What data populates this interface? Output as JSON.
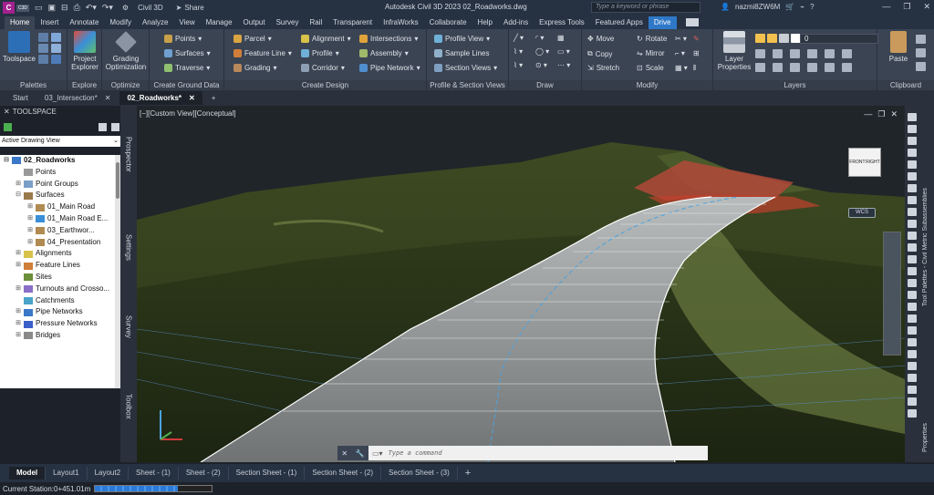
{
  "titlebar": {
    "badge": "C",
    "badge_sub": "C3D",
    "workspace": "Civil 3D",
    "share": "Share",
    "title": "Autodesk Civil 3D 2023   02_Roadworks.dwg",
    "search_placeholder": "Type a keyword or phrase",
    "user": "nazmi8ZW6M"
  },
  "ribbon_tabs": [
    "Home",
    "Insert",
    "Annotate",
    "Modify",
    "Analyze",
    "View",
    "Manage",
    "Output",
    "Survey",
    "Rail",
    "Transparent",
    "InfraWorks",
    "Collaborate",
    "Help",
    "Add-ins",
    "Express Tools",
    "Featured Apps",
    "Drive"
  ],
  "ribbon": {
    "palettes": {
      "toolspace": "Toolspace",
      "title": "Palettes"
    },
    "explore": {
      "project_explorer": "Project Explorer",
      "title": "Explore"
    },
    "optimize": {
      "grading_optimization": "Grading Optimization",
      "title": "Optimize"
    },
    "ground": {
      "points": "Points",
      "surfaces": "Surfaces",
      "traverse": "Traverse",
      "title": "Create Ground Data"
    },
    "design": {
      "parcel": "Parcel",
      "feature_line": "Feature Line",
      "grading": "Grading",
      "alignment": "Alignment",
      "profile": "Profile",
      "corridor": "Corridor",
      "intersections": "Intersections",
      "assembly": "Assembly",
      "pipe_network": "Pipe Network",
      "title": "Create Design"
    },
    "profile_section": {
      "profile_view": "Profile View",
      "sample_lines": "Sample Lines",
      "section_views": "Section Views",
      "title": "Profile & Section Views"
    },
    "draw": {
      "title": "Draw"
    },
    "modify": {
      "move": "Move",
      "copy": "Copy",
      "stretch": "Stretch",
      "rotate": "Rotate",
      "mirror": "Mirror",
      "scale": "Scale",
      "title": "Modify"
    },
    "layers": {
      "layer_properties": "Layer Properties",
      "current_layer": "0",
      "title": "Layers"
    },
    "clipboard": {
      "paste": "Paste",
      "title": "Clipboard"
    }
  },
  "file_tabs": [
    {
      "label": "Start",
      "closable": false
    },
    {
      "label": "03_Intersection*",
      "closable": true
    },
    {
      "label": "02_Roadworks*",
      "closable": true,
      "active": true
    }
  ],
  "toolspace": {
    "title": "TOOLSPACE",
    "view_select": "Active Drawing View",
    "tree": [
      {
        "label": "02_Roadworks",
        "indent": 0,
        "exp": "⊟",
        "icon": "drawing",
        "bold": true
      },
      {
        "label": "Points",
        "indent": 1,
        "exp": "",
        "icon": "points"
      },
      {
        "label": "Point Groups",
        "indent": 1,
        "exp": "⊞",
        "icon": "pointgroups"
      },
      {
        "label": "Surfaces",
        "indent": 1,
        "exp": "⊟",
        "icon": "surfaces"
      },
      {
        "label": "01_Main Road",
        "indent": 2,
        "exp": "⊞",
        "icon": "surface"
      },
      {
        "label": "01_Main Road E...",
        "indent": 2,
        "exp": "⊞",
        "icon": "surface-blue"
      },
      {
        "label": "03_Earthwor...",
        "indent": 2,
        "exp": "⊞",
        "icon": "surface"
      },
      {
        "label": "04_Presentation",
        "indent": 2,
        "exp": "⊞",
        "icon": "surface"
      },
      {
        "label": "Alignments",
        "indent": 1,
        "exp": "⊞",
        "icon": "alignments"
      },
      {
        "label": "Feature Lines",
        "indent": 1,
        "exp": "⊞",
        "icon": "featurelines"
      },
      {
        "label": "Sites",
        "indent": 1,
        "exp": "",
        "icon": "sites"
      },
      {
        "label": "Turnouts and Crosso...",
        "indent": 1,
        "exp": "⊞",
        "icon": "turnouts"
      },
      {
        "label": "Catchments",
        "indent": 1,
        "exp": "",
        "icon": "catchments"
      },
      {
        "label": "Pipe Networks",
        "indent": 1,
        "exp": "⊞",
        "icon": "pipes"
      },
      {
        "label": "Pressure Networks",
        "indent": 1,
        "exp": "⊞",
        "icon": "pressure"
      },
      {
        "label": "Bridges",
        "indent": 1,
        "exp": "⊞",
        "icon": "bridges"
      }
    ],
    "side_tabs": [
      "Prospector",
      "Settings",
      "Survey",
      "Toolbox"
    ]
  },
  "viewport": {
    "label": "[−][Custom View][Conceptual]",
    "viewcube_front": "FRONT",
    "viewcube_right": "RIGHT",
    "wcs": "WCS",
    "command_placeholder": "Type a command"
  },
  "right_palettes": [
    "Tool Palettes - Civil Metric Subassemblies",
    "Properties"
  ],
  "layout_tabs": [
    "Model",
    "Layout1",
    "Layout2",
    "Sheet - (1)",
    "Sheet - (2)",
    "Section Sheet - (1)",
    "Section Sheet - (2)",
    "Section Sheet - (3)"
  ],
  "status": {
    "station": "Current Station:0+451.01m",
    "progress": 0.71
  },
  "colors": {
    "accent": "#2e78c7",
    "badge": "#a3218e",
    "ribbon_bg": "#3b4453",
    "terrain": "#3a4a1e",
    "road": "#8a8d8d",
    "cut": "#c0402f"
  }
}
